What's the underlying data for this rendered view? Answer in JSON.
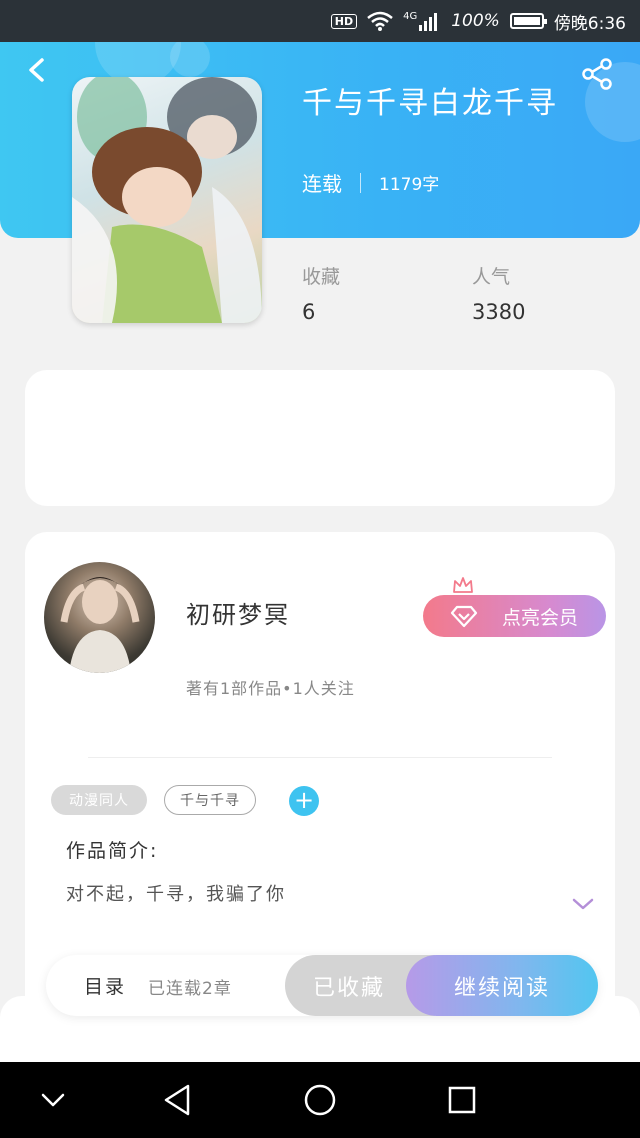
{
  "status_bar": {
    "hd": "HD",
    "network": "4G",
    "battery": "100%",
    "time": "傍晚6:36"
  },
  "book": {
    "title": "千与千寻白龙千寻",
    "status": "连载",
    "words": "1179字",
    "favorites_label": "收藏",
    "favorites_value": "6",
    "popularity_label": "人气",
    "popularity_value": "3380"
  },
  "author": {
    "name": "初研梦冥",
    "info": "著有1部作品•1人关注",
    "vip_label": "点亮会员"
  },
  "tags": [
    "动漫同人",
    "千与千寻"
  ],
  "intro": {
    "label": "作品简介:",
    "text": "对不起，千寻，我骗了你"
  },
  "action_bar": {
    "toc_label": "目录",
    "toc_count": "已连载2章",
    "collected_label": "已收藏",
    "read_label": "继续阅读"
  },
  "icons": {
    "back": "back-icon",
    "share": "share-icon",
    "wifi": "wifi-icon",
    "signal": "signal-icon",
    "battery": "battery-icon",
    "crown": "crown-icon",
    "diamond": "diamond-icon",
    "add": "plus-icon",
    "expand": "chevron-down-icon",
    "nav_down": "chevron-down-icon",
    "nav_back": "triangle-back-icon",
    "nav_home": "circle-home-icon",
    "nav_recents": "square-recents-icon"
  },
  "colors": {
    "header": "#39b2f5",
    "vip_start": "#f37a8b",
    "vip_end": "#b995e6",
    "read_start": "#b69ae8",
    "read_end": "#52c6f0"
  }
}
